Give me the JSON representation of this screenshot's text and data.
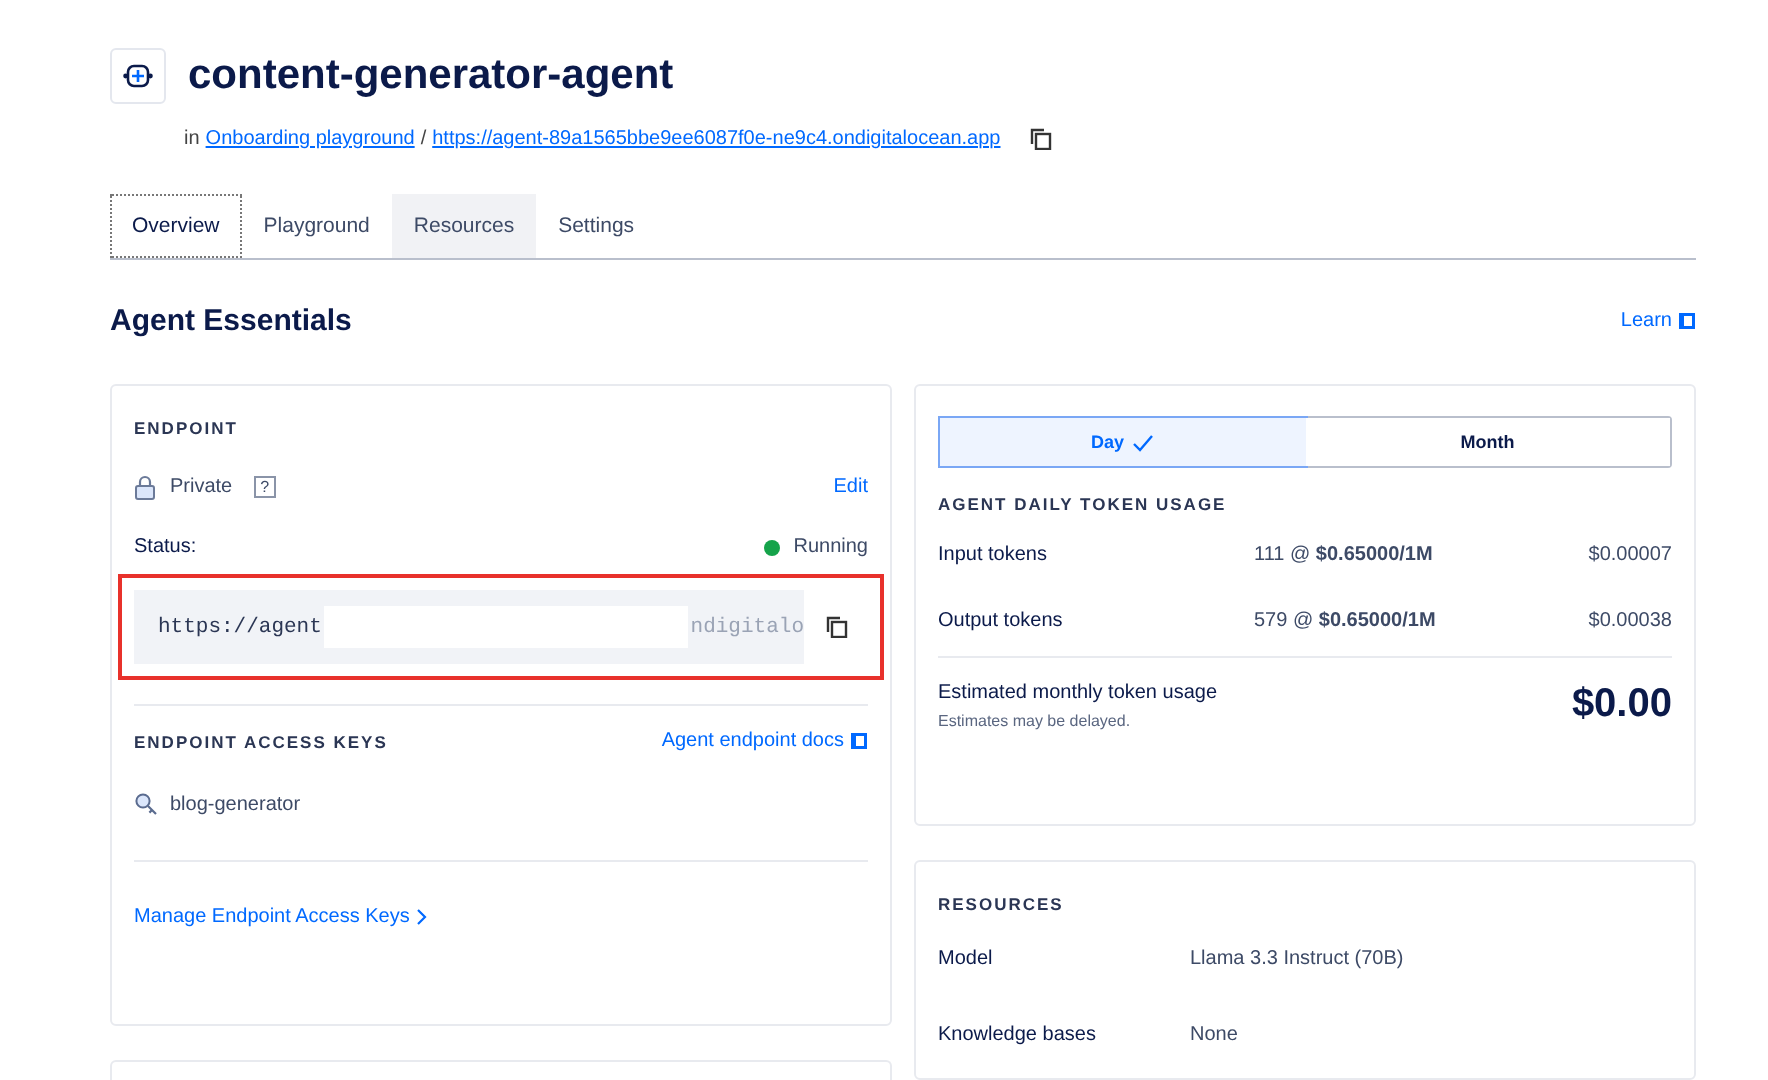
{
  "header": {
    "title": "content-generator-agent",
    "prefix": "in",
    "project_link": "Onboarding playground",
    "separator": "/",
    "url_link": "https://agent-89a1565bbe9ee6087f0e-ne9c4.ondigitalocean.app"
  },
  "tabs": [
    {
      "label": "Overview",
      "selected": true,
      "highlighted": false
    },
    {
      "label": "Playground",
      "selected": false,
      "highlighted": false
    },
    {
      "label": "Resources",
      "selected": false,
      "highlighted": true
    },
    {
      "label": "Settings",
      "selected": false,
      "highlighted": false
    }
  ],
  "section": {
    "title": "Agent Essentials",
    "learn_link": "Learn"
  },
  "endpoint": {
    "heading": "ENDPOINT",
    "visibility": "Private",
    "help": "?",
    "edit": "Edit",
    "status_label": "Status:",
    "status": "Running",
    "color": "#15a34a",
    "url_start": "https://agent",
    "url_end": "ndigitalo",
    "outlined": true
  },
  "access_keys": {
    "heading": "ENDPOINT ACCESS KEYS",
    "docs_link": "Agent endpoint docs",
    "keys": [
      "blog-generator"
    ],
    "manage_link": "Manage Endpoint Access Keys"
  },
  "usage": {
    "periods": [
      {
        "label": "Day",
        "selected": true
      },
      {
        "label": "Month",
        "selected": false
      }
    ],
    "heading": "AGENT DAILY TOKEN USAGE",
    "rows": [
      {
        "label": "Input tokens",
        "rate": "111 @ **$0.65000/1M**",
        "cost": "$0.00007"
      },
      {
        "label": "Output tokens",
        "rate": "579 @ **$0.65000/1M**",
        "cost": "$0.00038"
      }
    ],
    "estimate_label": "Estimated monthly token usage",
    "estimate_note": "Estimates may be delayed.",
    "estimate_value": "$0.00"
  },
  "resources": {
    "heading": "RESOURCES",
    "rows": [
      {
        "label": "Model",
        "value": "Llama 3.3 Instruct (70B)"
      },
      {
        "label": "Knowledge bases",
        "value": "None"
      }
    ]
  }
}
